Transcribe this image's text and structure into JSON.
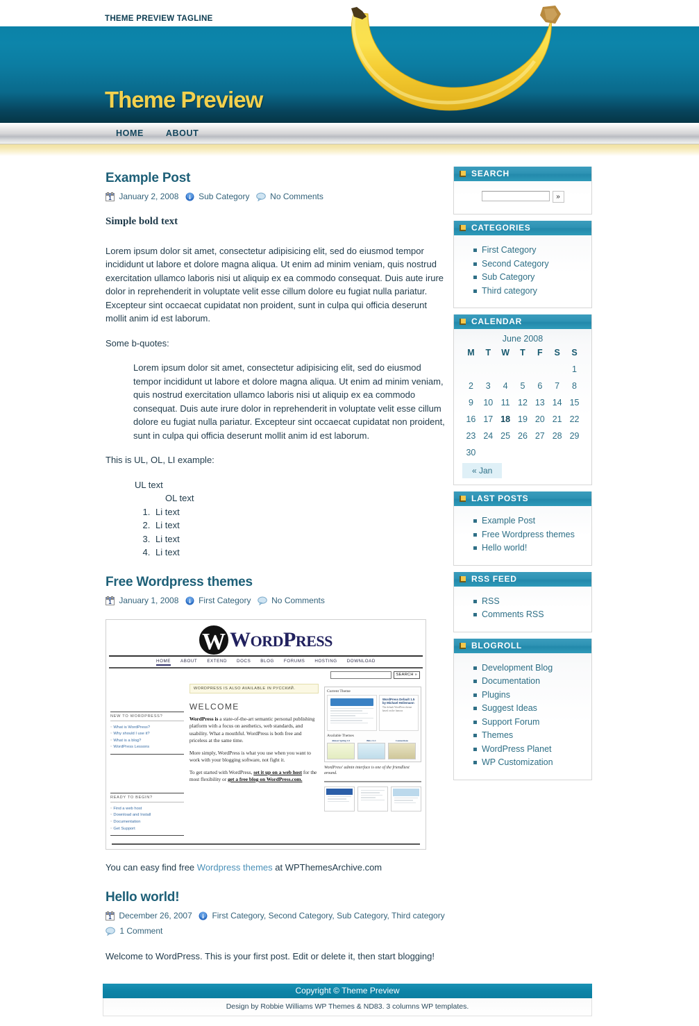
{
  "header": {
    "tagline": "THEME PREVIEW TAGLINE",
    "title": "Theme Preview",
    "banana_icon": "banana-image"
  },
  "nav": {
    "items": [
      {
        "label": "HOME"
      },
      {
        "label": "ABOUT"
      }
    ]
  },
  "posts": [
    {
      "title": "Example Post",
      "date": "January 2, 2008",
      "category": "Sub Category",
      "comments": "No Comments",
      "bold_lead": "Simple bold text",
      "paragraph1": "Lorem ipsum dolor sit amet, consectetur adipisicing elit, sed do eiusmod tempor incididunt ut labore et dolore magna aliqua. Ut enim ad minim veniam, quis nostrud exercitation ullamco laboris nisi ut aliquip ex ea commodo consequat. Duis aute irure dolor in reprehenderit in voluptate velit esse cillum dolore eu fugiat nulla pariatur. Excepteur sint occaecat cupidatat non proident, sunt in culpa qui officia deserunt mollit anim id est laborum.",
      "bquote_intro": "Some b-quotes:",
      "blockquote": "Lorem ipsum dolor sit amet, consectetur adipisicing elit, sed do eiusmod tempor incididunt ut labore et dolore magna aliqua. Ut enim ad minim veniam, quis nostrud exercitation ullamco laboris nisi ut aliquip ex ea commodo consequat. Duis aute irure dolor in reprehenderit in voluptate velit esse cillum dolore eu fugiat nulla pariatur. Excepteur sint occaecat cupidatat non proident, sunt in culpa qui officia deserunt mollit anim id est laborum.",
      "list_intro": "This is UL, OL, LI example:",
      "ul_text": "UL text",
      "ol_text": "OL text",
      "li_items": [
        "Li text",
        "Li text",
        "Li text",
        "Li text"
      ]
    },
    {
      "title": "Free Wordpress themes",
      "date": "January 1, 2008",
      "category": "First Category",
      "comments": "No Comments",
      "closing_pre": "You can easy find free ",
      "closing_link": "Wordpress themes",
      "closing_post": " at WPThemesArchive.com"
    },
    {
      "title": "Hello world!",
      "date": "December 26, 2007",
      "category": "First Category, Second Category, Sub Category, Third category",
      "comments": "1 Comment",
      "paragraph1": "Welcome to WordPress. This is your first post. Edit or delete it, then start blogging!"
    }
  ],
  "wporg_screenshot": {
    "brand_mark": "W",
    "brand_word": "ORD",
    "brand_word2": "RESS",
    "brand_cap1": "W",
    "brand_cap2": "P",
    "nav": [
      "HOME",
      "ABOUT",
      "EXTEND",
      "DOCS",
      "BLOG",
      "FORUMS",
      "HOSTING",
      "DOWNLOAD"
    ],
    "search_button": "SEARCH »",
    "notice": "WORDPRESS IS ALSO AVAILABLE IN РУССКИЙ.",
    "welcome": "WELCOME",
    "para1_bold": "WordPress is",
    "para1": " a state-of-the-art semantic personal publishing platform with a focus on aesthetics, web standards, and usability. What a mouthful. WordPress is both free and priceless at the same time.",
    "para2": "More simply, WordPress is what you use when you want to work with your blogging software, not fight it.",
    "para3_pre": "To get started with WordPress, ",
    "para3_link1": "set it up on a web host",
    "para3_mid": " for the most flexibility or ",
    "para3_link2": "get a free blog on WordPress.com.",
    "sec1_head": "NEW TO WORDPRESS?",
    "sec1_links": [
      "What is WordPress?",
      "Why should I use it?",
      "What is a blog?",
      "WordPress Lessons"
    ],
    "sec2_head": "READY TO BEGIN?",
    "sec2_links": [
      "Find a web host",
      "Download and Install",
      "Documentation",
      "Get Support"
    ],
    "panel_title": "Current Theme",
    "panel_sub": "WordPress Default 1.5 by Michael Heilemann",
    "panel_text": "The default WordPress theme based on the famous",
    "available": "Available Themes",
    "themes": [
      "Almost Spring 1.0",
      "Blix 2.1.1",
      "Connections"
    ],
    "caption": "WordPress' admin interface is one of the friendliest around."
  },
  "sidebar": {
    "widgets": [
      {
        "title": "SEARCH",
        "type": "search",
        "input_value": "",
        "input_placeholder": "",
        "button_label": "»"
      },
      {
        "title": "CATEGORIES",
        "type": "list",
        "items": [
          "First Category",
          "Second Category",
          "Sub Category",
          "Third category"
        ]
      },
      {
        "title": "CALENDAR",
        "type": "calendar"
      },
      {
        "title": "LAST POSTS",
        "type": "list",
        "items": [
          "Example Post",
          "Free Wordpress themes",
          "Hello world!"
        ]
      },
      {
        "title": "RSS FEED",
        "type": "list",
        "items": [
          "RSS",
          "Comments RSS"
        ]
      },
      {
        "title": "BLOGROLL",
        "type": "list",
        "items": [
          "Development Blog",
          "Documentation",
          "Plugins",
          "Suggest Ideas",
          "Support Forum",
          "Themes",
          "WordPress Planet",
          "WP Customization"
        ]
      }
    ]
  },
  "calendar": {
    "caption": "June 2008",
    "weekdays": [
      "M",
      "T",
      "W",
      "T",
      "F",
      "S",
      "S"
    ],
    "weeks": [
      [
        "",
        "",
        "",
        "",
        "",
        "",
        "1"
      ],
      [
        "2",
        "3",
        "4",
        "5",
        "6",
        "7",
        "8"
      ],
      [
        "9",
        "10",
        "11",
        "12",
        "13",
        "14",
        "15"
      ],
      [
        "16",
        "17",
        "18",
        "19",
        "20",
        "21",
        "22"
      ],
      [
        "23",
        "24",
        "25",
        "26",
        "27",
        "28",
        "29"
      ],
      [
        "30",
        "",
        "",
        "",
        "",
        "",
        ""
      ]
    ],
    "today": "18",
    "prev_label": "« Jan"
  },
  "footer": {
    "copyright": "Copyright © Theme Preview",
    "credits": "Design by Robbie Williams WP Themes & ND83. 3 columns WP templates."
  },
  "colors": {
    "banner_teal": "#0d85aa",
    "widget_header": "#2389ab",
    "title_yellow": "#f2d14e",
    "link_teal": "#2e6f86",
    "heading_teal": "#1d5f77"
  }
}
